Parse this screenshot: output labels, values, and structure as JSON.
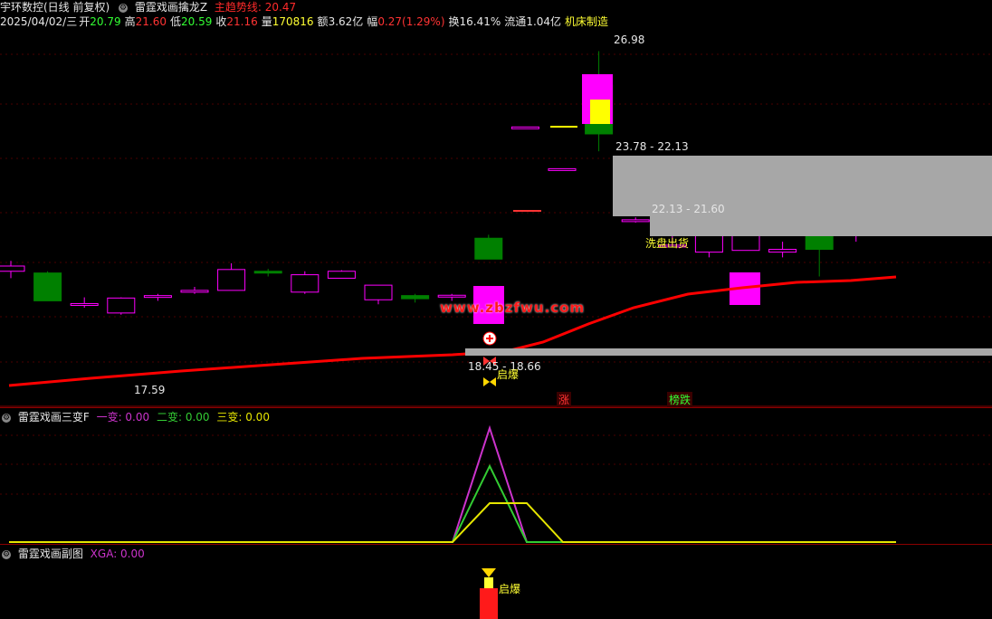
{
  "header": {
    "stock_name": "宇环数控(日线 前复权)",
    "indicator_name": "雷霆戏画擒龙Z",
    "main_line_label": "主趋势线: 20.47",
    "date": "2025/04/02/三",
    "open_label": "开",
    "open": "20.79",
    "high_label": "高",
    "high": "21.60",
    "low_label": "低",
    "low": "20.59",
    "close_label": "收",
    "close": "21.16",
    "volume_label": "量",
    "volume": "170816",
    "amount_label": "额",
    "amount": "3.62亿",
    "change_label": "幅",
    "change": "0.27(1.29%)",
    "turnover_label": "换",
    "turnover": "16.41%",
    "float_label": "流通",
    "float_cap": "1.04亿",
    "sector": "机床制造"
  },
  "annotations": {
    "high_price": "26.98",
    "zone_upper": "23.78 - 22.13",
    "zone_middle": "22.13 - 21.60",
    "zone_lower": "18.45 - 18.66",
    "low_price": "17.59",
    "wash_out": "洗盘出货",
    "signal_qiyao": "启爆",
    "limit_up": "涨",
    "limit_down": "榜跌",
    "watermark": "www.zbzfwu.com"
  },
  "sub1": {
    "name": "雷霆戏画三变F",
    "v1": "一变: 0.00",
    "v2": "二变: 0.00",
    "v3": "三变: 0.00"
  },
  "sub2": {
    "name": "雷霆戏画副图",
    "xga": "XGA: 0.00",
    "signal": "启爆"
  },
  "colors": {
    "up": "#ff00ff",
    "down": "#008000",
    "trend": "#ff0000",
    "zone": "#a7a7a7",
    "line1": "#cc33cc",
    "line2": "#33cc33",
    "line3": "#e6e600"
  },
  "candles": [
    {
      "o": 20.65,
      "h": 20.95,
      "l": 20.45,
      "c": 20.8
    },
    {
      "o": 20.6,
      "h": 20.65,
      "l": 19.8,
      "c": 19.8
    },
    {
      "o": 19.7,
      "h": 19.9,
      "l": 19.6,
      "c": 19.72
    },
    {
      "o": 19.45,
      "h": 19.9,
      "l": 19.4,
      "c": 19.88
    },
    {
      "o": 19.9,
      "h": 20.0,
      "l": 19.8,
      "c": 19.95
    },
    {
      "o": 20.06,
      "h": 20.2,
      "l": 20.0,
      "c": 20.1
    },
    {
      "o": 20.1,
      "h": 20.88,
      "l": 20.1,
      "c": 20.7
    },
    {
      "o": 20.65,
      "h": 20.72,
      "l": 20.5,
      "c": 20.62
    },
    {
      "o": 20.05,
      "h": 20.65,
      "l": 20.0,
      "c": 20.55
    },
    {
      "o": 20.45,
      "h": 20.68,
      "l": 20.45,
      "c": 20.65
    },
    {
      "o": 19.83,
      "h": 20.25,
      "l": 19.7,
      "c": 20.25
    },
    {
      "o": 19.95,
      "h": 20.0,
      "l": 19.75,
      "c": 19.86
    },
    {
      "o": 19.94,
      "h": 20.0,
      "l": 19.8,
      "c": 19.96
    },
    {
      "o": 21.6,
      "h": 21.7,
      "l": 21.0,
      "c": 21.0
    },
    {
      "o": 24.8,
      "h": 24.8,
      "l": 24.8,
      "c": 24.8
    },
    {
      "o": 23.6,
      "h": 23.6,
      "l": 23.6,
      "c": 23.6
    },
    {
      "o": 26.0,
      "h": 26.98,
      "l": 24.1,
      "c": 24.6
    },
    {
      "o": 22.13,
      "h": 22.2,
      "l": 22.05,
      "c": 22.13
    },
    {
      "o": 21.35,
      "h": 21.85,
      "l": 21.35,
      "c": 21.4
    },
    {
      "o": 21.2,
      "h": 22.0,
      "l": 21.05,
      "c": 21.85
    },
    {
      "o": 21.25,
      "h": 21.85,
      "l": 21.25,
      "c": 21.85
    },
    {
      "o": 21.2,
      "h": 21.5,
      "l": 21.05,
      "c": 21.28
    },
    {
      "o": 21.75,
      "h": 21.85,
      "l": 20.5,
      "c": 21.28
    },
    {
      "o": 21.85,
      "h": 22.0,
      "l": 21.5,
      "c": 22.05
    },
    {
      "o": 22.0,
      "h": 22.35,
      "l": 21.95,
      "c": 22.22
    }
  ]
}
